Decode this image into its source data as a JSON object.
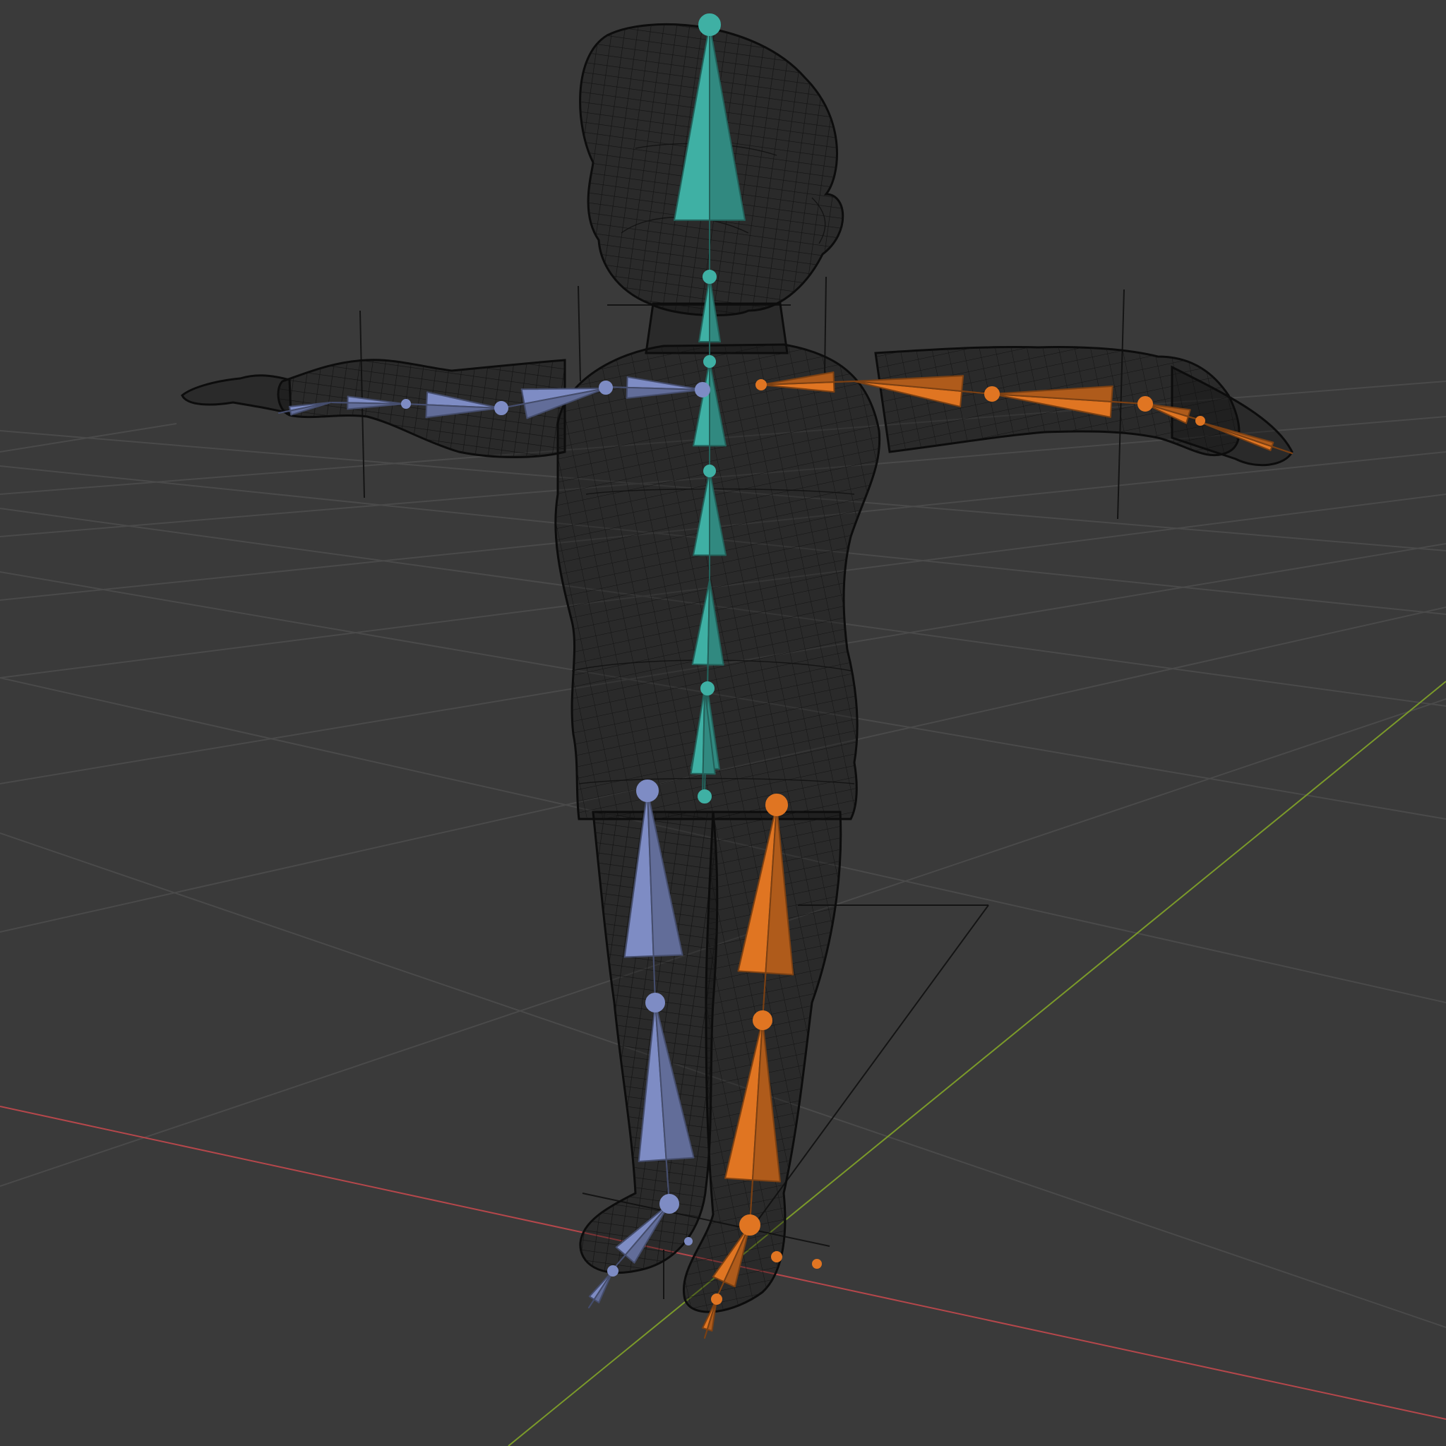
{
  "viewport": {
    "mode": "pose",
    "shading": "wireframe",
    "background_color": "#3a3a3a",
    "grid_color": "#4a4a4a",
    "x_axis_color": "#b5474b",
    "y_axis_color": "#7b9a2a"
  },
  "armature": {
    "center_color": "#3fb0a4",
    "left_color": "#7e8cc4",
    "right_color": "#e07522",
    "bones": [
      "head",
      "neck",
      "spine-upper",
      "spine-chest",
      "spine-mid",
      "spine-low",
      "hips",
      "shoulder-l",
      "upper-arm-l",
      "forearm-l",
      "hand-l",
      "fingers-l",
      "shoulder-r",
      "upper-arm-r",
      "forearm-r",
      "hand-r",
      "fingers-r",
      "thigh-l",
      "shin-l",
      "foot-l",
      "toe-l",
      "thigh-r",
      "shin-r",
      "foot-r",
      "toe-r"
    ]
  },
  "mesh": {
    "name": "character-mesh",
    "display": "wireframe",
    "wire_color": "#0c0c0c"
  }
}
